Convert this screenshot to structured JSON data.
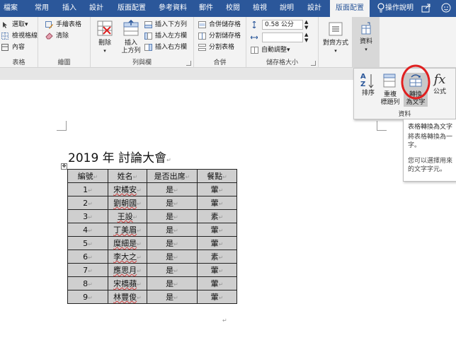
{
  "tabs": [
    {
      "label": "檔案",
      "active": false
    },
    {
      "label": "常用",
      "active": false
    },
    {
      "label": "插入",
      "active": false
    },
    {
      "label": "設計",
      "active": false
    },
    {
      "label": "版面配置",
      "active": false
    },
    {
      "label": "參考資料",
      "active": false
    },
    {
      "label": "郵件",
      "active": false
    },
    {
      "label": "校閱",
      "active": false
    },
    {
      "label": "檢視",
      "active": false
    },
    {
      "label": "說明",
      "active": false
    },
    {
      "label": "設計",
      "active": false
    },
    {
      "label": "版面配置",
      "active": true
    }
  ],
  "tellme": "操作說明",
  "ribbon": {
    "table_group": {
      "select": "選取",
      "gridlines": "檢視格線",
      "properties": "內容",
      "label": "表格"
    },
    "draw_group": {
      "draw": "手繪表格",
      "erase": "清除",
      "label": "繪圖"
    },
    "rowscols_group": {
      "delete": "刪除",
      "insert_above_1": "插入",
      "insert_above_2": "上方列",
      "insert_below": "插入下方列",
      "insert_left": "插入左方欄",
      "insert_right": "插入右方欄",
      "label": "列與欄"
    },
    "merge_group": {
      "merge": "合併儲存格",
      "split_cells": "分割儲存格",
      "split_table": "分割表格",
      "label": "合併"
    },
    "cellsize_group": {
      "height": "0.58 公分",
      "width": "",
      "autofit": "自動調整",
      "label": "儲存格大小"
    },
    "align_group": {
      "label": "對齊方式"
    },
    "data_group": {
      "label": "資料"
    }
  },
  "data_popup": {
    "sort": "排序",
    "repeat_1": "重複",
    "repeat_2": "標題列",
    "convert_1": "轉換",
    "convert_2": "為文字",
    "formula": "公式",
    "label": "資料",
    "formula_icon": "fx",
    "sort_icon_top": "A",
    "sort_icon_bottom": "Z"
  },
  "tooltip": {
    "title": "表格轉換為文字",
    "line1": "將表格轉換為一",
    "line2": "字。",
    "line3": "您可以選擇用來",
    "line4": "的文字字元。"
  },
  "document": {
    "title": "2019  年  討論大會",
    "headers": [
      "編號",
      "姓名",
      "是否出席",
      "餐點"
    ],
    "rows": [
      [
        "1",
        "宋橘安",
        "是",
        "葷"
      ],
      [
        "2",
        "劉朝國",
        "是",
        "葷"
      ],
      [
        "3",
        "王設",
        "是",
        "素"
      ],
      [
        "4",
        "丁美眉",
        "是",
        "葷"
      ],
      [
        "5",
        "糜細是",
        "是",
        "葷"
      ],
      [
        "6",
        "李大之",
        "是",
        "素"
      ],
      [
        "7",
        "應思月",
        "是",
        "葷"
      ],
      [
        "8",
        "宋橋蘋",
        "是",
        "葷"
      ],
      [
        "9",
        "林豐俊",
        "是",
        "葷"
      ]
    ]
  },
  "colors": {
    "brand": "#2b579a",
    "highlight": "#e02020"
  }
}
